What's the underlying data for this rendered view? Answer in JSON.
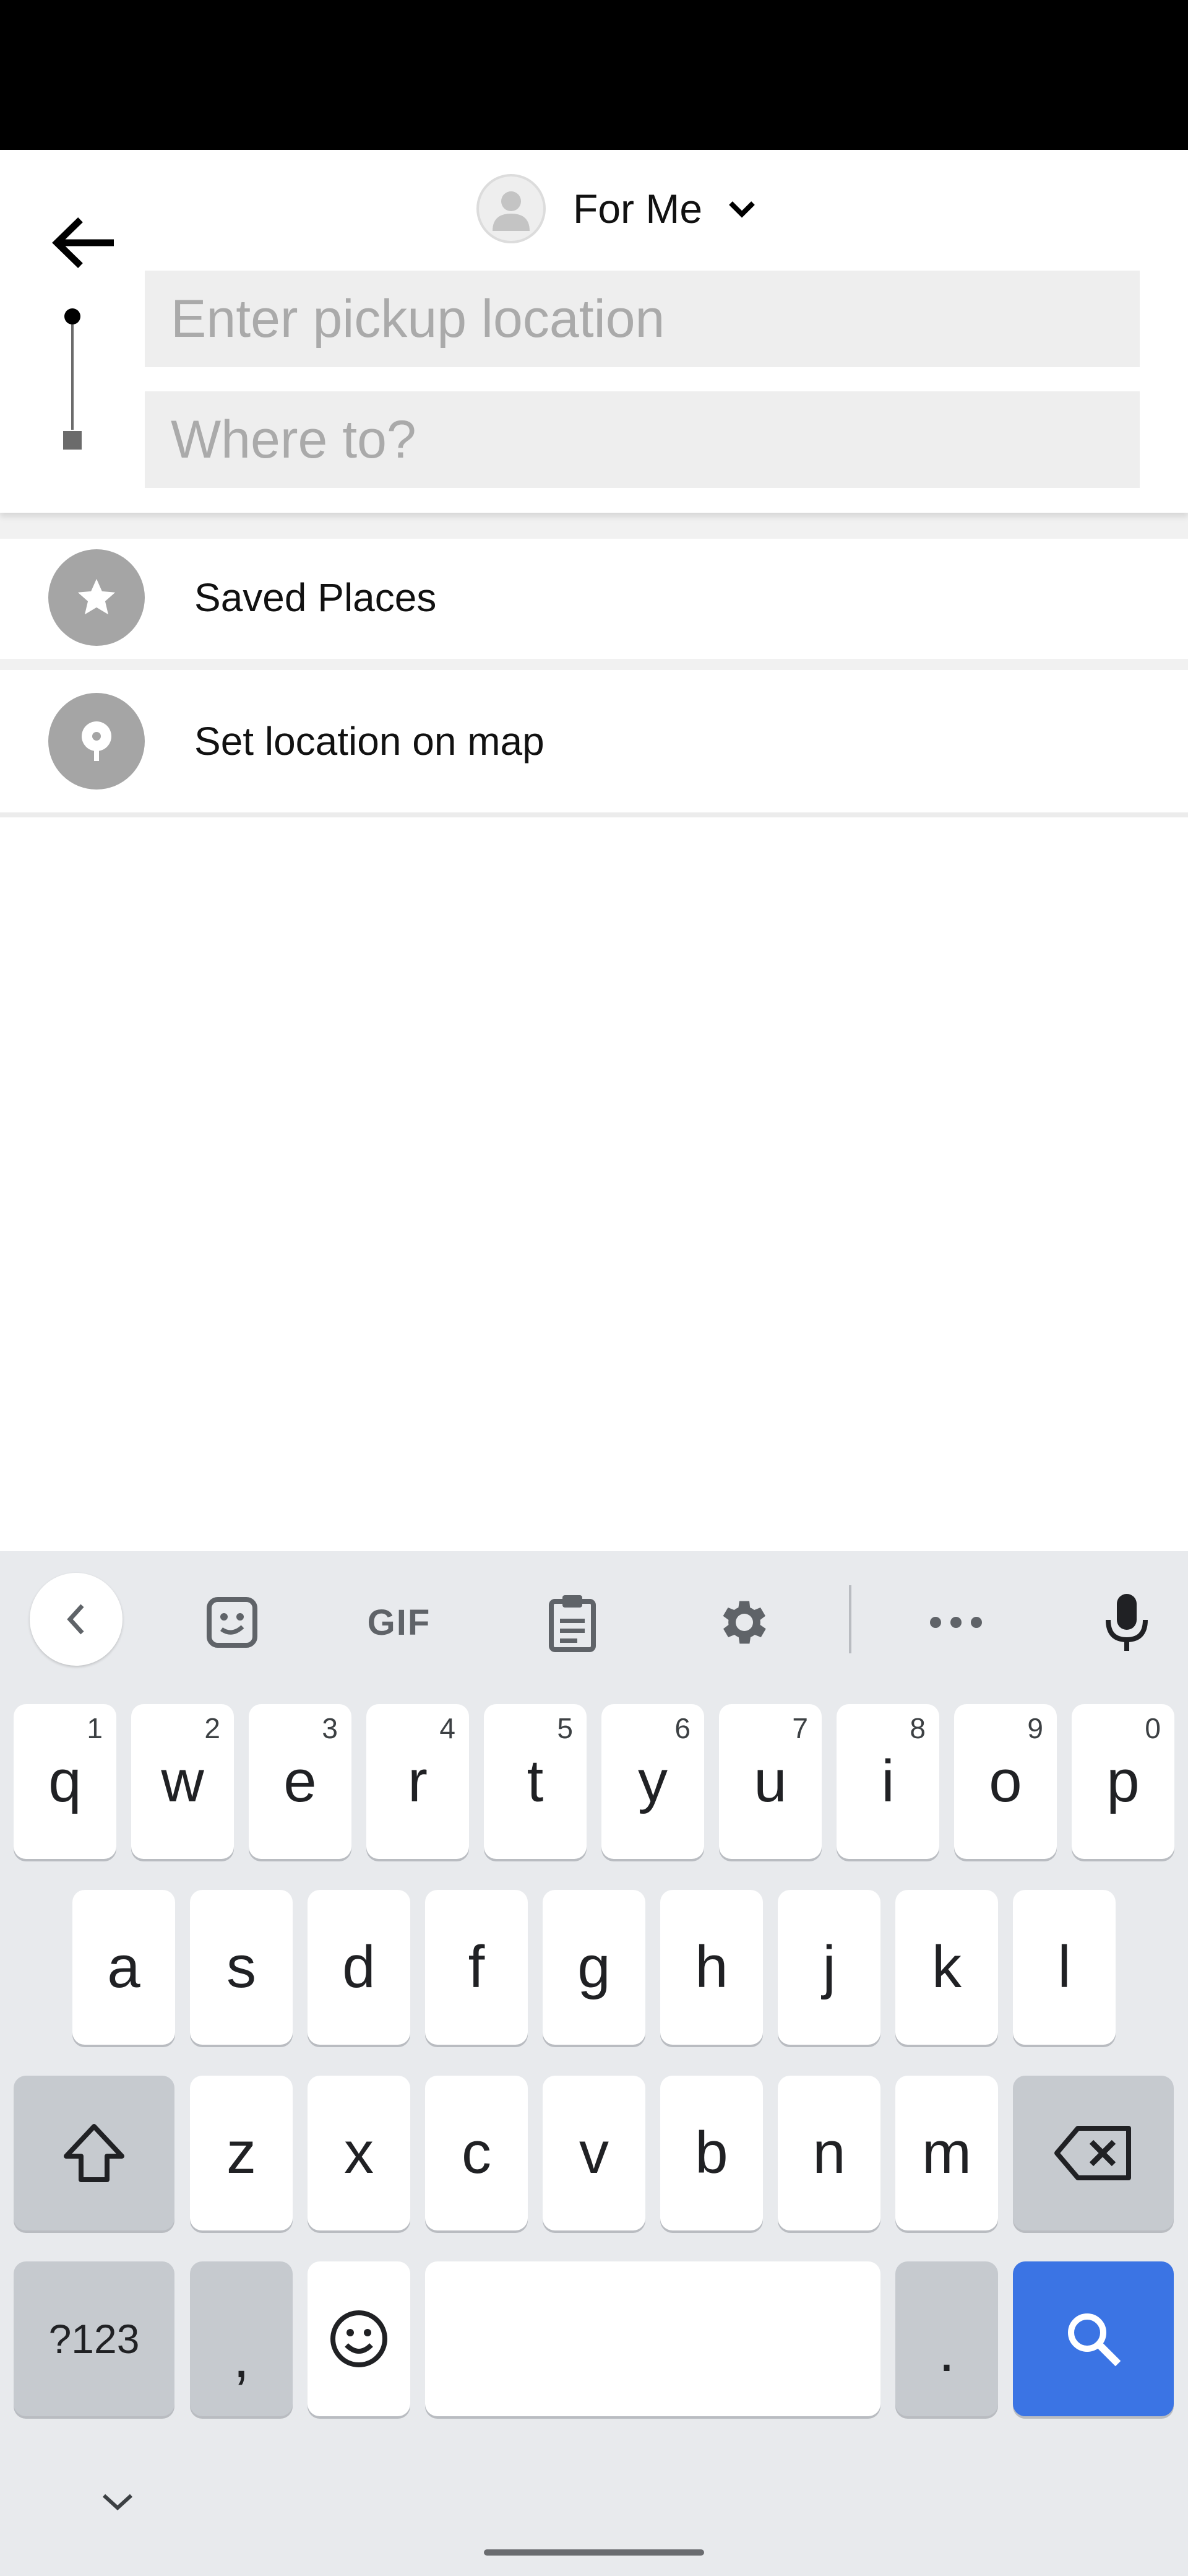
{
  "header": {
    "rider_label": "For Me",
    "pickup_placeholder": "Enter pickup location",
    "destination_placeholder": "Where to?"
  },
  "list": {
    "items": [
      {
        "label": "Saved Places",
        "icon": "star-icon"
      },
      {
        "label": "Set location on map",
        "icon": "map-pin-icon"
      }
    ]
  },
  "keyboard": {
    "toolbar": {
      "gif_label": "GIF",
      "icons": [
        "chevron-left-icon",
        "sticker-icon",
        "clipboard-icon",
        "settings-icon",
        "more-icon",
        "microphone-icon"
      ]
    },
    "row1": [
      {
        "key": "q",
        "hint": "1"
      },
      {
        "key": "w",
        "hint": "2"
      },
      {
        "key": "e",
        "hint": "3"
      },
      {
        "key": "r",
        "hint": "4"
      },
      {
        "key": "t",
        "hint": "5"
      },
      {
        "key": "y",
        "hint": "6"
      },
      {
        "key": "u",
        "hint": "7"
      },
      {
        "key": "i",
        "hint": "8"
      },
      {
        "key": "o",
        "hint": "9"
      },
      {
        "key": "p",
        "hint": "0"
      }
    ],
    "row2": [
      "a",
      "s",
      "d",
      "f",
      "g",
      "h",
      "j",
      "k",
      "l"
    ],
    "row3": [
      "z",
      "x",
      "c",
      "v",
      "b",
      "n",
      "m"
    ],
    "symbols_label": "?123",
    "comma": ",",
    "period": ".",
    "colors": {
      "search_key": "#3b74e4",
      "background": "#e8eaed"
    }
  }
}
